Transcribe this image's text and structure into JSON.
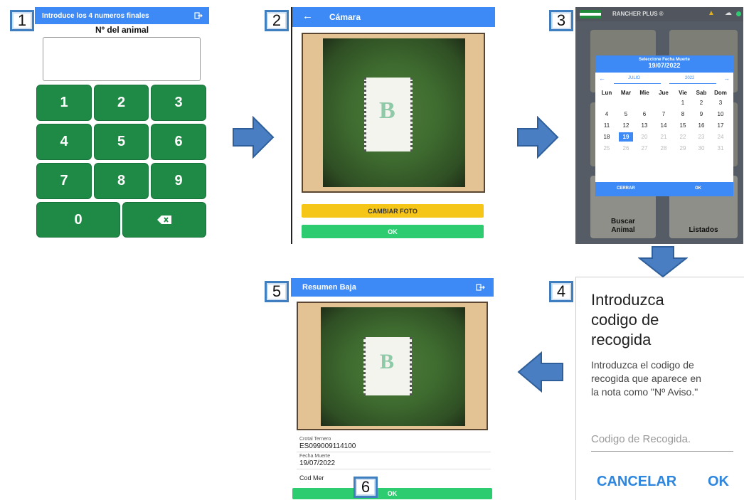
{
  "steps": [
    "1",
    "2",
    "3",
    "4",
    "5",
    "6"
  ],
  "screen1": {
    "header": "Introduce los 4 numeros finales",
    "label": "Nº del animal",
    "keys": [
      "1",
      "2",
      "3",
      "4",
      "5",
      "6",
      "7",
      "8",
      "9",
      "0"
    ],
    "backspace_icon": "backspace-icon"
  },
  "screen2": {
    "title": "Cámara",
    "back_icon": "arrow-left-icon",
    "change_photo": "CAMBIAR FOTO",
    "ok": "OK"
  },
  "screen3": {
    "app_title": "RANCHER PLUS ®",
    "dialog_title": "Seleccione Fecha Muerte",
    "dialog_date": "19/07/2022",
    "month": "JULIO",
    "year": "2022",
    "weekdays": [
      "Lun",
      "Mar",
      "Mie",
      "Jue",
      "Vie",
      "Sab",
      "Dom"
    ],
    "weeks": [
      [
        "",
        "",
        "",
        "",
        "1",
        "2",
        "3"
      ],
      [
        "4",
        "5",
        "6",
        "7",
        "8",
        "9",
        "10"
      ],
      [
        "11",
        "12",
        "13",
        "14",
        "15",
        "16",
        "17"
      ],
      [
        "18",
        "19",
        "20",
        "21",
        "22",
        "23",
        "24"
      ],
      [
        "25",
        "26",
        "27",
        "28",
        "29",
        "30",
        "31"
      ]
    ],
    "selected_day": "19",
    "close": "CERRAR",
    "ok": "OK",
    "tile_search": "Buscar\nAnimal",
    "tile_search_line1": "Buscar",
    "tile_search_line2": "Animal",
    "tile_lists": "Listados"
  },
  "screen4": {
    "title_line1": "Introduzca",
    "title_line2": "codigo de",
    "title_line3": "recogida",
    "body_line1": "Introduzca el codigo de",
    "body_line2": "recogida que aparece en",
    "body_line3": "la nota como \"Nº Aviso.\"",
    "placeholder": "Codigo de Recogida.",
    "cancel": "CANCELAR",
    "ok": "OK"
  },
  "screen5": {
    "title": "Resumen Baja",
    "logout_icon": "logout-icon",
    "fields": [
      {
        "label": "Crotal Ternero",
        "value": "ES099009114100"
      },
      {
        "label": "Fecha Muerte",
        "value": "19/07/2022"
      }
    ],
    "cod_mer": "Cod Mer",
    "ok": "OK"
  },
  "colors": {
    "appbar": "#3d8af7",
    "key_green": "#1f8a45",
    "ok_green": "#2ecc71",
    "yellow": "#f5c518",
    "arrow_blue": "#4a7ec2",
    "dialog_blue": "#3d8af7"
  }
}
